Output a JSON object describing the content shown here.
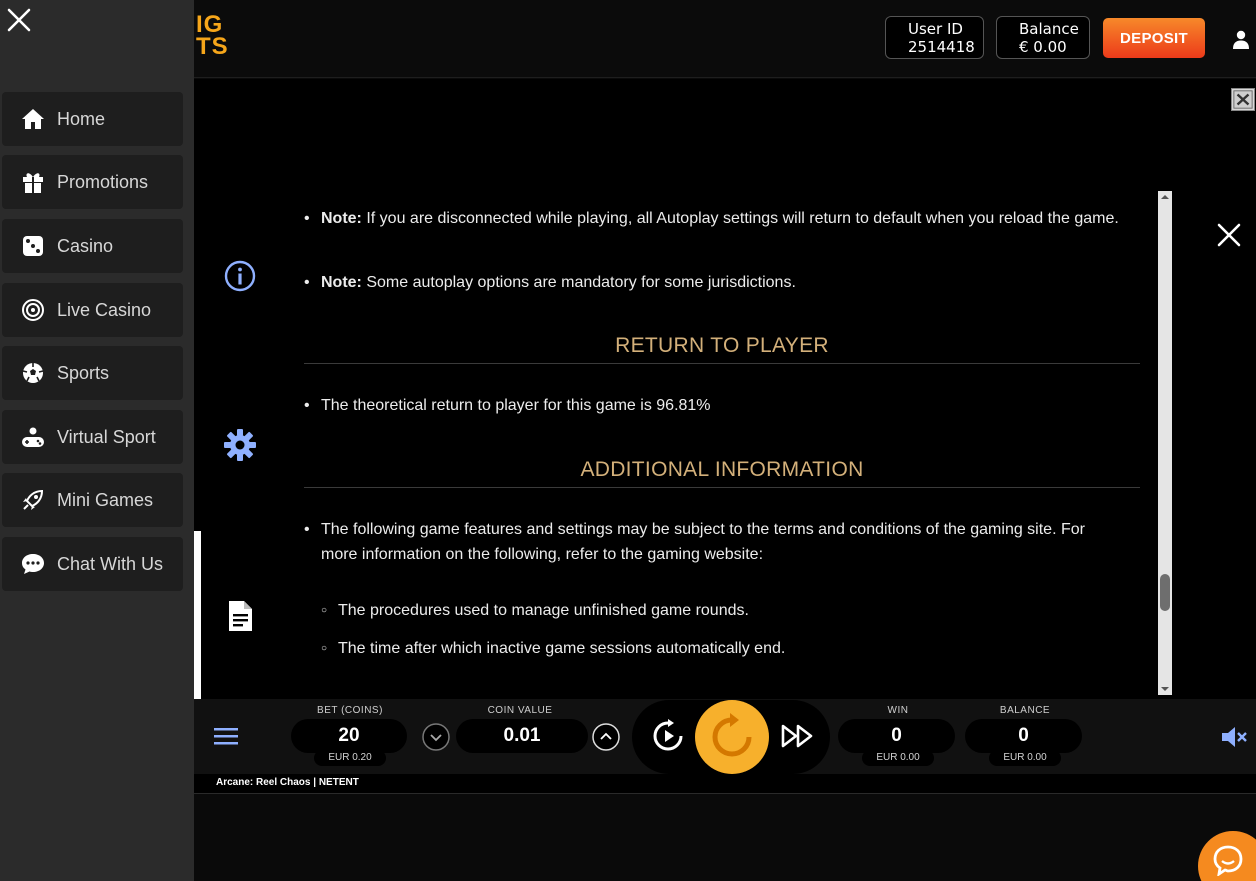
{
  "header": {
    "logo_text": "IG\nTS",
    "user_id_label": "User ID",
    "user_id_value": "2514418",
    "balance_label": "Balance",
    "balance_value": "€ 0.00",
    "deposit_label": "DEPOSIT",
    "deposit_color": "#f15a22"
  },
  "sidebar": {
    "items": [
      {
        "label": "Home",
        "icon": "home-icon"
      },
      {
        "label": "Promotions",
        "icon": "gift-icon"
      },
      {
        "label": "Casino",
        "icon": "dice-icon"
      },
      {
        "label": "Live Casino",
        "icon": "roulette-icon"
      },
      {
        "label": "Sports",
        "icon": "soccer-ball-icon"
      },
      {
        "label": "Virtual Sport",
        "icon": "gamepad-icon"
      },
      {
        "label": "Mini Games",
        "icon": "rocket-icon"
      },
      {
        "label": "Chat With Us",
        "icon": "chat-icon"
      }
    ]
  },
  "help": {
    "note1_bold": "Note:",
    "note1_text": " If you are disconnected while playing, all Autoplay settings will return to default when you reload the game.",
    "note2_bold": "Note:",
    "note2_text": " Some autoplay options are mandatory for some jurisdictions.",
    "rtp_title": "RETURN TO PLAYER",
    "rtp_text": "The theoretical return to player for this game is 96.81%",
    "additional_title": "ADDITIONAL INFORMATION",
    "additional_text": "The following game features and settings may be subject to the terms and conditions of the gaming site. For more information on the following, refer to the gaming website:",
    "sub1": "The procedures used to manage unfinished game rounds.",
    "sub2": "The time after which inactive game sessions automatically end.",
    "title_color": "#d3b07a"
  },
  "controls": {
    "bet_label": "BET (COINS)",
    "bet_value": "20",
    "bet_sub": "EUR 0.20",
    "coin_label": "COIN VALUE",
    "coin_value": "0.01",
    "win_label": "WIN",
    "win_value": "0",
    "win_sub": "EUR 0.00",
    "balance_label": "BALANCE",
    "balance_value": "0",
    "balance_sub": "EUR 0.00",
    "spin_color": "#f7b02c"
  },
  "footer": {
    "game_name": "Arcane: Reel Chaos  |  NETENT"
  }
}
